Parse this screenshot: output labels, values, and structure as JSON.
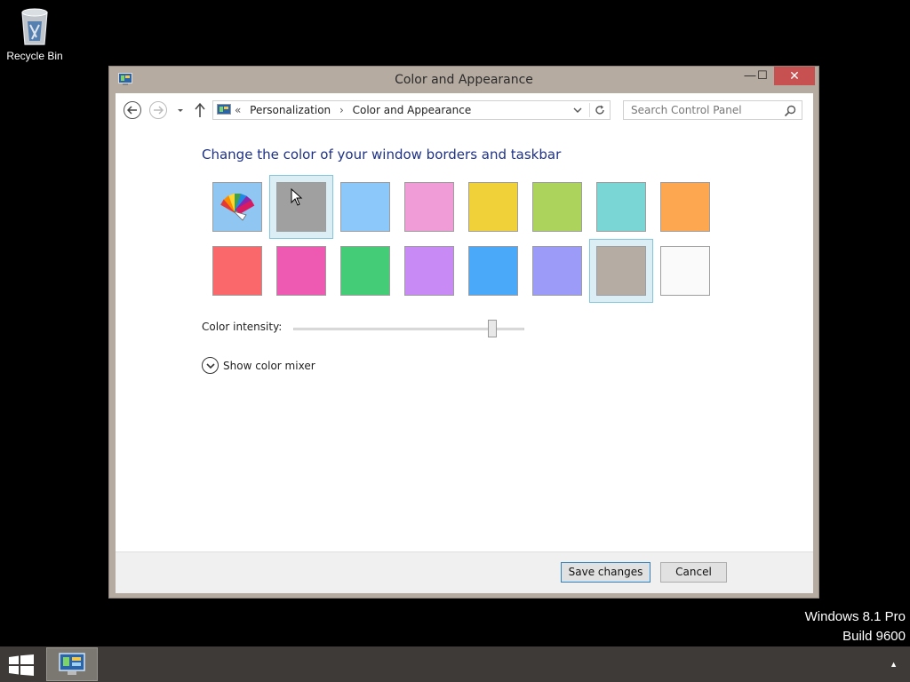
{
  "desktop": {
    "recycle_bin_label": "Recycle Bin"
  },
  "window": {
    "title": "Color and Appearance",
    "controls": {
      "minimize": "—",
      "maximize": "☐",
      "close": "✕"
    }
  },
  "navbar": {
    "breadcrumb_prefix": "«",
    "breadcrumb": [
      "Personalization",
      "Color and Appearance"
    ],
    "breadcrumb_separator": "›",
    "search_placeholder": "Search Control Panel"
  },
  "content": {
    "heading": "Change the color of your window borders and taskbar",
    "swatches": [
      {
        "name": "automatic",
        "color": "#ffffff"
      },
      {
        "name": "gray",
        "color": "#a0a0a0",
        "hover": true
      },
      {
        "name": "light-blue",
        "color": "#8dc8fb"
      },
      {
        "name": "pink",
        "color": "#f09cd6"
      },
      {
        "name": "yellow",
        "color": "#f1d13a"
      },
      {
        "name": "lime",
        "color": "#acd45c"
      },
      {
        "name": "teal",
        "color": "#79d6d4"
      },
      {
        "name": "orange",
        "color": "#fda850"
      },
      {
        "name": "red",
        "color": "#fb686b"
      },
      {
        "name": "magenta",
        "color": "#ee59b1"
      },
      {
        "name": "green",
        "color": "#44cd76"
      },
      {
        "name": "purple",
        "color": "#c88bf5"
      },
      {
        "name": "blue",
        "color": "#4aa9f8"
      },
      {
        "name": "periwinkle",
        "color": "#9c9bf8"
      },
      {
        "name": "taupe",
        "color": "#b5aca3",
        "selected": true
      },
      {
        "name": "white",
        "color": "#fafafa"
      }
    ],
    "intensity_label": "Color intensity:",
    "intensity_value": 0.86,
    "mixer_label": "Show color mixer"
  },
  "footer": {
    "save_label": "Save changes",
    "cancel_label": "Cancel"
  },
  "watermark": {
    "line1": "Windows 8.1 Pro",
    "line2": "Build 9600"
  },
  "colors": {
    "window_frame": "#b5aba1",
    "close_button": "#c75050",
    "heading": "#1e3287",
    "taskbar": "#3d3a37"
  }
}
